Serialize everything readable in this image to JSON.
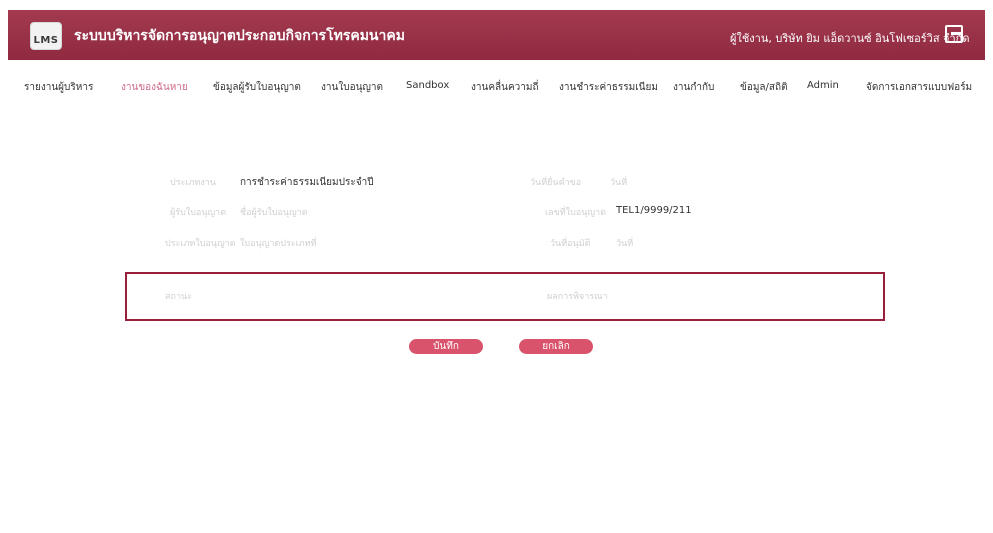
{
  "header": {
    "logo_text": "LMS",
    "title": "ระบบบริหารจัดการอนุญาตประกอบกิจการโทรคมนาคม",
    "user_info": "ผู้ใช้งาน, บริษัท ยิม แอ็ดวานซ์ อินโฟเซอร์วิส จำกัด"
  },
  "nav": {
    "items": [
      "รายงานผู้บริหาร",
      "งานของฉันหาย",
      "ข้อมูลผู้รับใบอนุญาต",
      "งานใบอนุญาต",
      "Sandbox",
      "งานคลื่นความถี่",
      "งานชำระค่าธรรมเนียม",
      "งานกำกับ",
      "ข้อมูล/สถิติ",
      "Admin",
      "จัดการเอกสารแบบฟอร์ม"
    ]
  },
  "form": {
    "row1_left_label": "ประเภทงาน",
    "row1_left_value": "การชำระค่าธรรมเนียมประจำปี",
    "row1_right_label": "วันที่ยื่นคำขอ",
    "row1_right_value": "วันที่",
    "row2_left_label": "ผู้รับใบอนุญาต",
    "row2_left_value": "ชื่อผู้รับใบอนุญาต",
    "row2_right_label": "เลขที่ใบอนุญาต",
    "row2_right_value": "TEL1/9999/211",
    "row3_left_label": "ประเภทใบอนุญาต",
    "row3_left_value": "ใบอนุญาตประเภทที่",
    "row3_right_label": "วันที่อนุมัติ",
    "row3_right_value": "วันที่",
    "box_left_label": "สถานะ",
    "box_right_label": "ผลการพิจารณา"
  },
  "buttons": {
    "save_label": "บันทึก",
    "cancel_label": "ยกเลิก"
  }
}
